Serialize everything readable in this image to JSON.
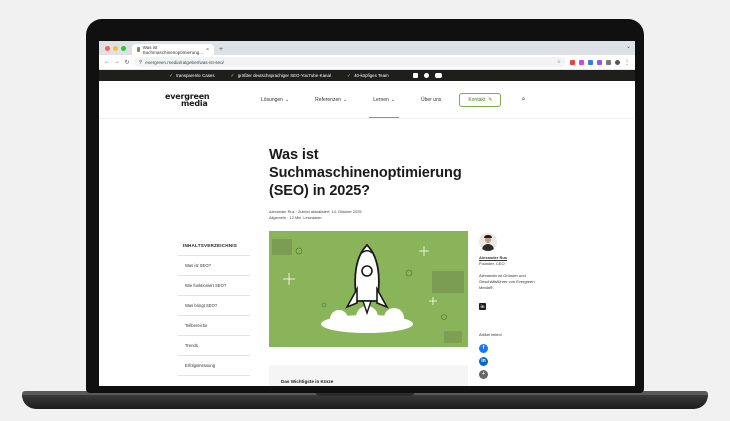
{
  "browser": {
    "tab_title": "Was ist Suchmaschinenoptimierung...",
    "tab_close": "×",
    "new_tab": "+",
    "url": "evergreen.media/ratgeber/was-ist-seo/",
    "traffic_colors": [
      "#ff5f57",
      "#febc2e",
      "#28c840"
    ]
  },
  "topbar": {
    "items": [
      "transparente Cases",
      "größter deutschsprachiger SEO-YouTube-Kanal",
      "40-köpfiges Team"
    ]
  },
  "header": {
    "logo_line1": "evergreen",
    "logo_line2": "media",
    "nav": [
      "Lösungen",
      "Referenzen",
      "Lernen",
      "Über uns"
    ],
    "kontakt": "Kontakt"
  },
  "toc": {
    "title": "INHALTSVERZEICHNIS",
    "items": [
      "Was ist SEO?",
      "Wie funktioniert SEO?",
      "Was bringt SEO?",
      "Teilbereiche",
      "Trends",
      "Erfolgsmessung"
    ]
  },
  "article": {
    "title_lines": [
      "Was ist",
      "Suchmaschinenoptimierung",
      "(SEO) in 2025?"
    ],
    "meta_line1": "Alexander Rus · Zuletzt aktualisiert: 14. Oktober 2025",
    "meta_line2": "Allgemein · 12 Min. Lesedauer",
    "summary_title": "Das Wichtigste in Kürze"
  },
  "author": {
    "name": "Alexander Rus",
    "role": "Founder, CEO",
    "desc": "Alexander ist Gründer und Geschäftsführer von Evergreen Media®.",
    "share_title": "Artikel teilen!"
  },
  "colors": {
    "accent": "#7fae45",
    "hero_bg": "#8ab459",
    "topbar_bg": "#1e1f1d"
  }
}
